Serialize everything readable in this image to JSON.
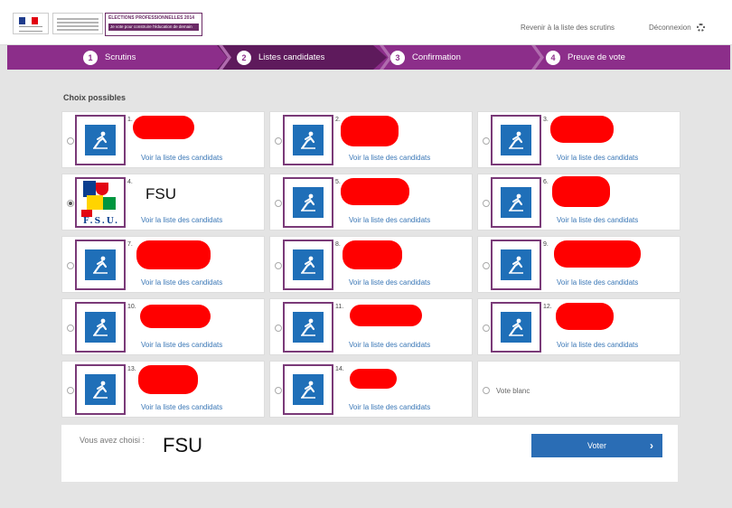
{
  "header": {
    "election_title": "ÉLECTIONS PROFESSIONNELLES 2014",
    "election_subtitle": "Je vote pour construire l'éducation de demain",
    "back_link": "Revenir à la liste des scrutins",
    "logout": "Déconnexion",
    "logout_icon": "gear-icon",
    "flag_colors": [
      "#1f3c8c",
      "#ffffff",
      "#e1000f"
    ]
  },
  "steps": [
    {
      "num": "1",
      "label": "Scrutins"
    },
    {
      "num": "2",
      "label": "Listes candidates",
      "active": true
    },
    {
      "num": "3",
      "label": "Confirmation"
    },
    {
      "num": "4",
      "label": "Preuve de vote"
    }
  ],
  "section_title": "Choix possibles",
  "link_label": "Voir la liste des candidats",
  "lists": [
    {
      "num": "1.",
      "icon": "curling-icon",
      "selected": false
    },
    {
      "num": "2.",
      "icon": "figure-skating-icon",
      "selected": false
    },
    {
      "num": "3.",
      "icon": "speed-skating-icon",
      "selected": false
    },
    {
      "num": "4.",
      "name": "FSU",
      "icon": "fsu-logo",
      "selected": true
    },
    {
      "num": "5.",
      "icon": "bobsleigh-icon",
      "selected": false
    },
    {
      "num": "6.",
      "icon": "cross-country-icon",
      "selected": false
    },
    {
      "num": "7.",
      "icon": "curling-icon",
      "selected": false
    },
    {
      "num": "8.",
      "icon": "alpine-ski-icon",
      "selected": false
    },
    {
      "num": "9.",
      "icon": "ski-jump-icon",
      "selected": false
    },
    {
      "num": "10.",
      "icon": "hockey-icon",
      "selected": false
    },
    {
      "num": "11.",
      "icon": "skeleton-icon",
      "selected": false
    },
    {
      "num": "12.",
      "icon": "figure-skating-icon",
      "selected": false
    },
    {
      "num": "13.",
      "icon": "snowboard-icon",
      "selected": false
    },
    {
      "num": "14.",
      "icon": "luge-icon",
      "selected": false
    }
  ],
  "vote_blanc": "Vote blanc",
  "footer": {
    "chosen_label": "Vous avez choisi :",
    "chosen_value": "FSU",
    "vote_button": "Voter",
    "vote_arrow": "›"
  },
  "colors": {
    "accent": "#8c2e8a",
    "accent_dark": "#5e1a5c",
    "pictogram": "#1f6fb8",
    "button": "#2a6db5",
    "redaction": "#ff0000"
  }
}
